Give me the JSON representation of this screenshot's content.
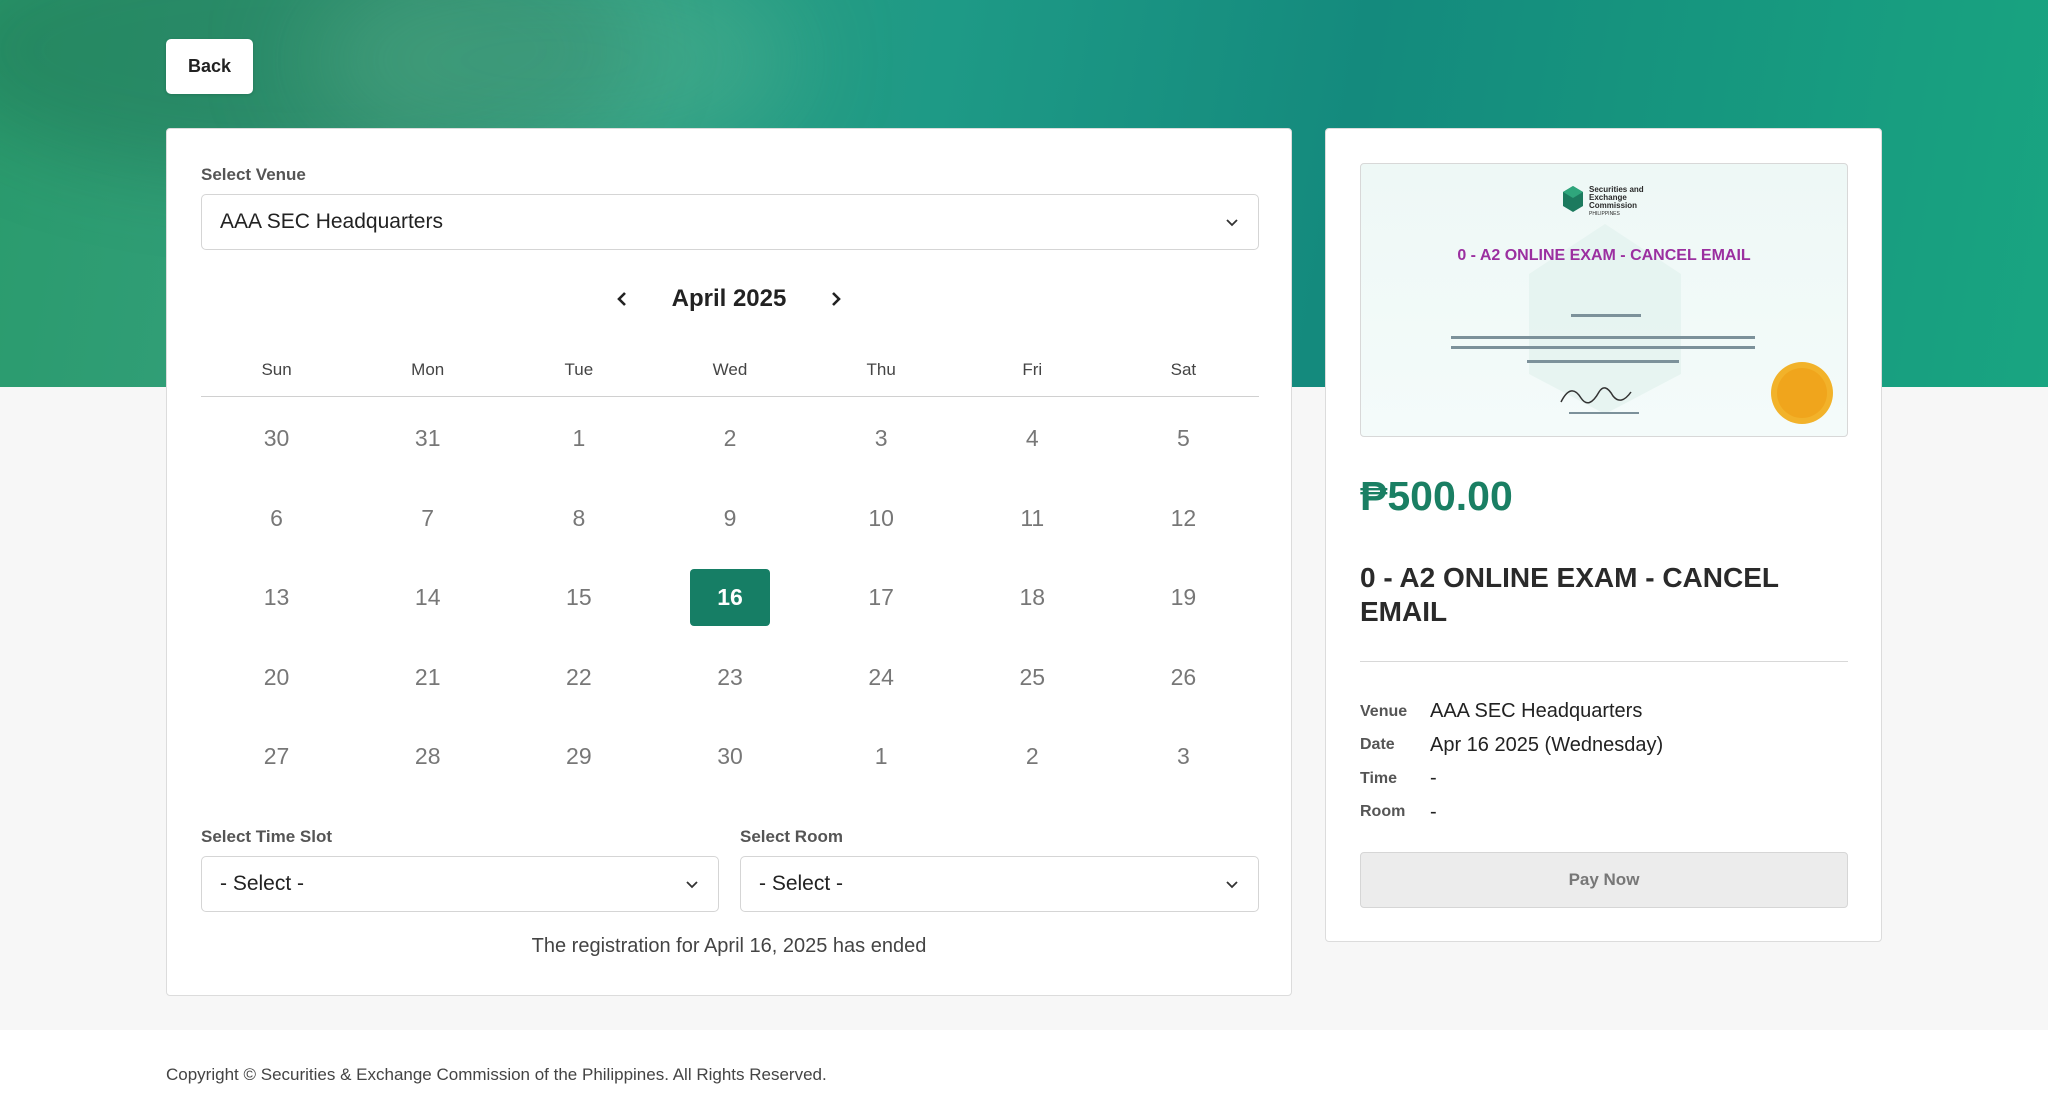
{
  "back_label": "Back",
  "venue": {
    "label": "Select Venue",
    "value": "AAA SEC Headquarters"
  },
  "calendar": {
    "month": "April 2025",
    "weekdays": [
      "Sun",
      "Mon",
      "Tue",
      "Wed",
      "Thu",
      "Fri",
      "Sat"
    ],
    "days": [
      "30",
      "31",
      "1",
      "2",
      "3",
      "4",
      "5",
      "6",
      "7",
      "8",
      "9",
      "10",
      "11",
      "12",
      "13",
      "14",
      "15",
      "16",
      "17",
      "18",
      "19",
      "20",
      "21",
      "22",
      "23",
      "24",
      "25",
      "26",
      "27",
      "28",
      "29",
      "30",
      "1",
      "2",
      "3"
    ],
    "selected_index": 17
  },
  "time_slot": {
    "label": "Select Time Slot",
    "value": "- Select -"
  },
  "room": {
    "label": "Select Room",
    "value": "- Select -"
  },
  "notice": "The registration for April 16, 2025 has ended",
  "summary": {
    "cert_title": "0 - A2 ONLINE EXAM - CANCEL EMAIL",
    "cert_logo_lines": [
      "Securities and",
      "Exchange",
      "Commission",
      "PHILIPPINES"
    ],
    "price": "₱500.00",
    "title": "0 - A2 ONLINE EXAM - CANCEL EMAIL",
    "details": [
      {
        "key": "Venue",
        "value": "AAA SEC Headquarters"
      },
      {
        "key": "Date",
        "value": "Apr 16 2025 (Wednesday)"
      },
      {
        "key": "Time",
        "value": "-"
      },
      {
        "key": "Room",
        "value": "-"
      }
    ],
    "pay_label": "Pay Now"
  },
  "footer": "Copyright © Securities & Exchange Commission of the Philippines. All Rights Reserved.",
  "colors": {
    "accent": "#167e65",
    "price": "#1a7f63",
    "cert_title": "#9b2fa0"
  }
}
